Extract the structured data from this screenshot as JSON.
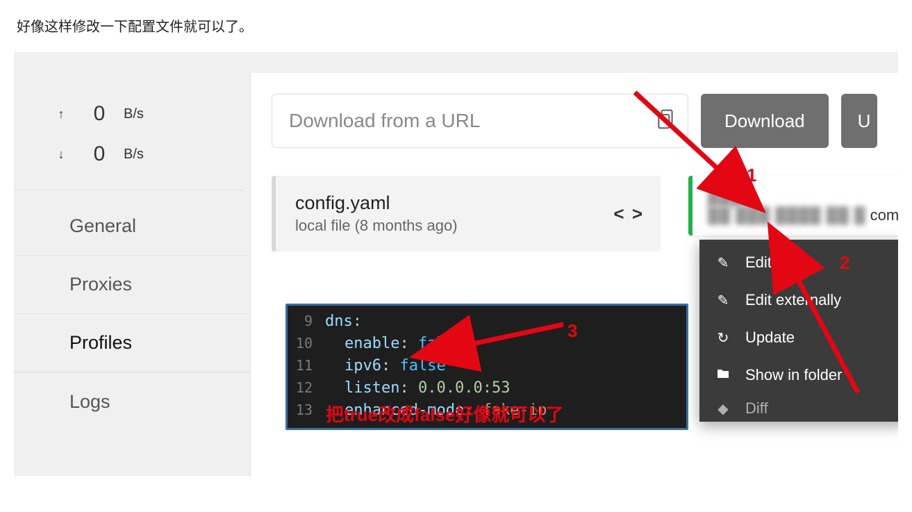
{
  "page": {
    "intro_text": "好像这样修改一下配置文件就可以了。"
  },
  "speed": {
    "up_value": "0",
    "up_unit": "B/s",
    "down_value": "0",
    "down_unit": "B/s"
  },
  "nav": {
    "general": "General",
    "proxies": "Proxies",
    "profiles": "Profiles",
    "logs": "Logs"
  },
  "toolbar": {
    "url_placeholder": "Download from a URL",
    "download_label": "Download",
    "update_label": "U"
  },
  "profile_card": {
    "name": "config.yaml",
    "subtitle": "local file (8 months ago)",
    "code_symbol": "< >"
  },
  "second_card": {
    "masked_title": "████",
    "domain_tail": "com (a",
    "masked_line": "██ ███ ████ ██ █"
  },
  "context_menu": {
    "edit": "Edit",
    "edit_ext": "Edit externally",
    "update": "Update",
    "show_folder": "Show in folder",
    "diff": "Diff"
  },
  "code": {
    "l9": {
      "n": "9",
      "t": "dns:"
    },
    "l10": {
      "n": "10",
      "k": "enable",
      "v": "false"
    },
    "l11": {
      "n": "11",
      "k": "ipv6",
      "v": "false"
    },
    "l12": {
      "n": "12",
      "k": "listen",
      "v": "0.0.0.0:53"
    },
    "l13": {
      "n": "13",
      "k": "enhanced-mode",
      "v": "fake-ip"
    }
  },
  "annotations": {
    "n1": "1",
    "n2": "2",
    "n3": "3",
    "note": "把true改成false好像就可以了"
  }
}
